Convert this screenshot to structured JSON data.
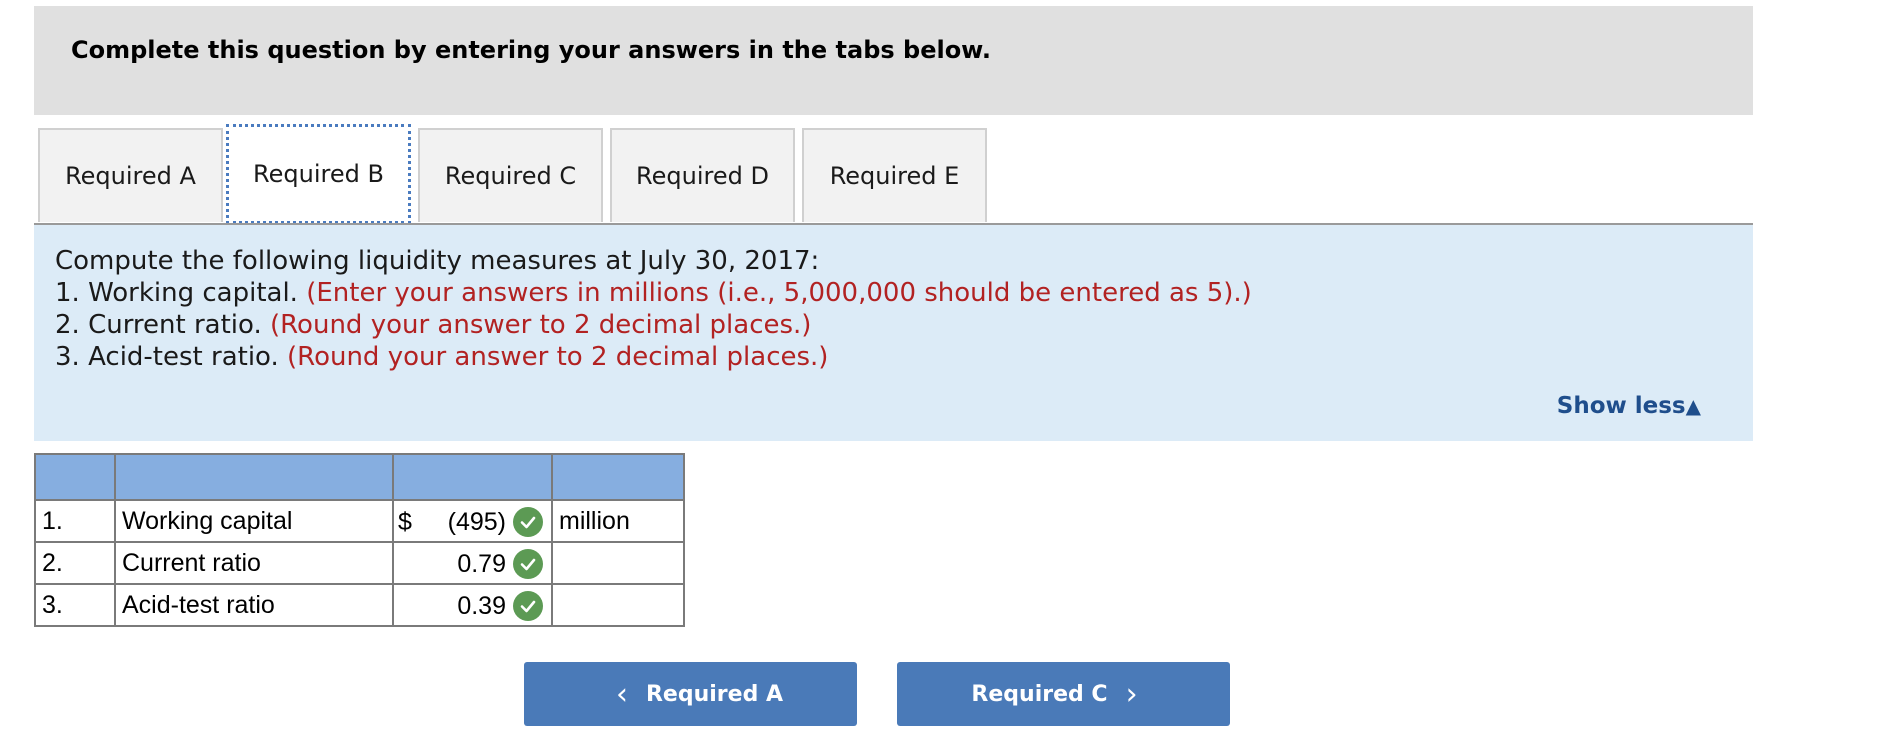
{
  "header": {
    "title": "Complete this question by entering your answers in the tabs below."
  },
  "tabs": [
    {
      "label": "Required A"
    },
    {
      "label": "Required B",
      "active": true
    },
    {
      "label": "Required C"
    },
    {
      "label": "Required D"
    },
    {
      "label": "Required E"
    }
  ],
  "instructions": {
    "line1": "Compute the following liquidity measures at July 30, 2017:",
    "line2_prefix": "1. Working capital.",
    "line2_note": "(Enter your answers in millions (i.e., 5,000,000 should be entered as 5).)",
    "line3_prefix": "2. Current ratio.",
    "line3_note": "(Round your answer to 2 decimal places.)",
    "line4_prefix": "3. Acid-test ratio.",
    "line4_note": "(Round your answer to 2 decimal places.)"
  },
  "show_less": {
    "label": "Show less",
    "icon": "triangle-up-icon"
  },
  "table": {
    "rows": [
      {
        "num": "1.",
        "label": "Working capital",
        "currency": "$",
        "value": "(495)",
        "unit": "million",
        "status": "correct"
      },
      {
        "num": "2.",
        "label": "Current ratio",
        "currency": "",
        "value": "0.79",
        "unit": "",
        "status": "correct"
      },
      {
        "num": "3.",
        "label": "Acid-test ratio",
        "currency": "",
        "value": "0.39",
        "unit": "",
        "status": "correct"
      }
    ]
  },
  "nav": {
    "prev_label": "Required A",
    "next_label": "Required C"
  },
  "colors": {
    "accent": "#4a7ab8",
    "note_red": "#b22222",
    "panel_blue": "#dcebf7",
    "table_header": "#86aee0",
    "check_green": "#5c9a54"
  }
}
